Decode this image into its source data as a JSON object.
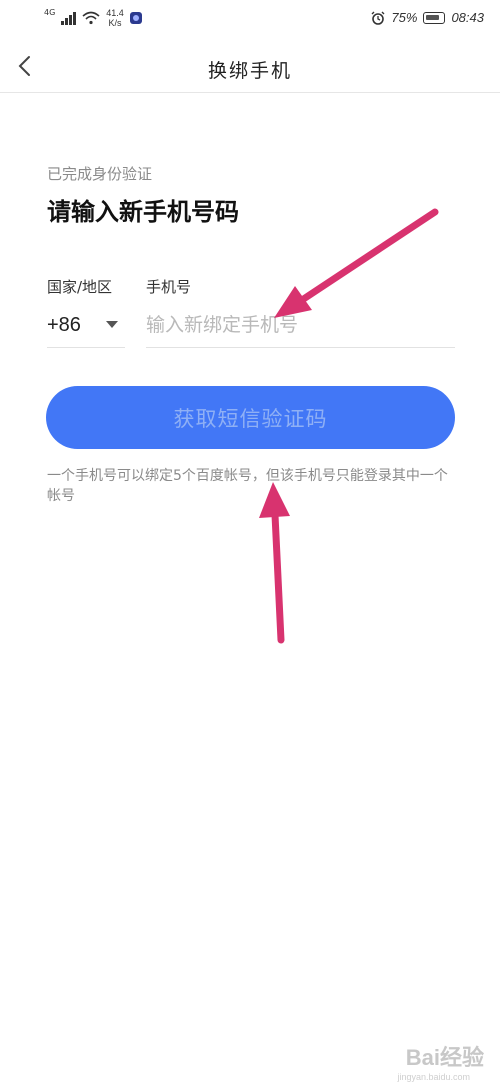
{
  "status_bar": {
    "network_type": "4G",
    "speed_value": "41.4",
    "speed_unit": "K/s",
    "battery_percent": "75%",
    "time": "08:43"
  },
  "nav": {
    "title": "换绑手机",
    "back_icon": "chevron-left-icon"
  },
  "form": {
    "verified_text": "已完成身份验证",
    "heading": "请输入新手机号码",
    "country_label": "国家/地区",
    "country_code": "+86",
    "phone_label": "手机号",
    "phone_placeholder": "输入新绑定手机号",
    "phone_value": "",
    "submit_label": "获取短信验证码",
    "note": "一个手机号可以绑定5个百度帐号，但该手机号只能登录其中一个帐号"
  },
  "watermark": {
    "text": "Bai经验",
    "sub": "jingyan.baidu.com"
  },
  "colors": {
    "accent": "#4277f6",
    "annotation": "#d8336f"
  }
}
